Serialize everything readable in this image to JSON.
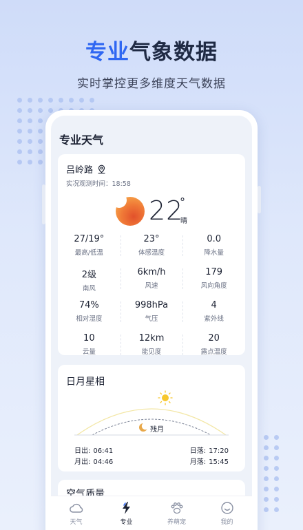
{
  "hero": {
    "title_accent": "专业",
    "title_rest": "气象数据",
    "subtitle": "实时掌控更多维度天气数据"
  },
  "app": {
    "page_title": "专业天气",
    "weather": {
      "location": "吕岭路",
      "observed": "实况观测时间：18:58",
      "temperature": "22",
      "degree": "°",
      "condition": "晴",
      "metrics": [
        {
          "value": "27/19°",
          "label": "最高/低温"
        },
        {
          "value": "23°",
          "label": "体感温度"
        },
        {
          "value": "0.0",
          "label": "降水量"
        },
        {
          "value": "2级",
          "label": "南风"
        },
        {
          "value": "6km/h",
          "label": "风速"
        },
        {
          "value": "179",
          "label": "风向角度"
        },
        {
          "value": "74%",
          "label": "相对湿度"
        },
        {
          "value": "998hPa",
          "label": "气压"
        },
        {
          "value": "4",
          "label": "紫外线"
        },
        {
          "value": "10",
          "label": "云量"
        },
        {
          "value": "12km",
          "label": "能见度"
        },
        {
          "value": "20",
          "label": "露点温度"
        }
      ]
    },
    "sun_moon": {
      "title": "日月星相",
      "moon_phase": "残月",
      "sunrise_label": "日出:",
      "sunrise": "06:41",
      "moonrise_label": "月出:",
      "moonrise": "04:46",
      "sunset_label": "日落:",
      "sunset": "17:20",
      "moonset_label": "月落:",
      "moonset": "15:45"
    },
    "air": {
      "title": "空气质量"
    },
    "tabs": [
      {
        "label": "天气",
        "icon": "weather-icon"
      },
      {
        "label": "专业",
        "icon": "lightning-icon",
        "active": true
      },
      {
        "label": "养萌宠",
        "icon": "paw-icon"
      },
      {
        "label": "我的",
        "icon": "smiley-icon"
      }
    ]
  },
  "colors": {
    "accent": "#2f67f2",
    "sun": "#f07a37",
    "background": "#dfe8fb"
  }
}
